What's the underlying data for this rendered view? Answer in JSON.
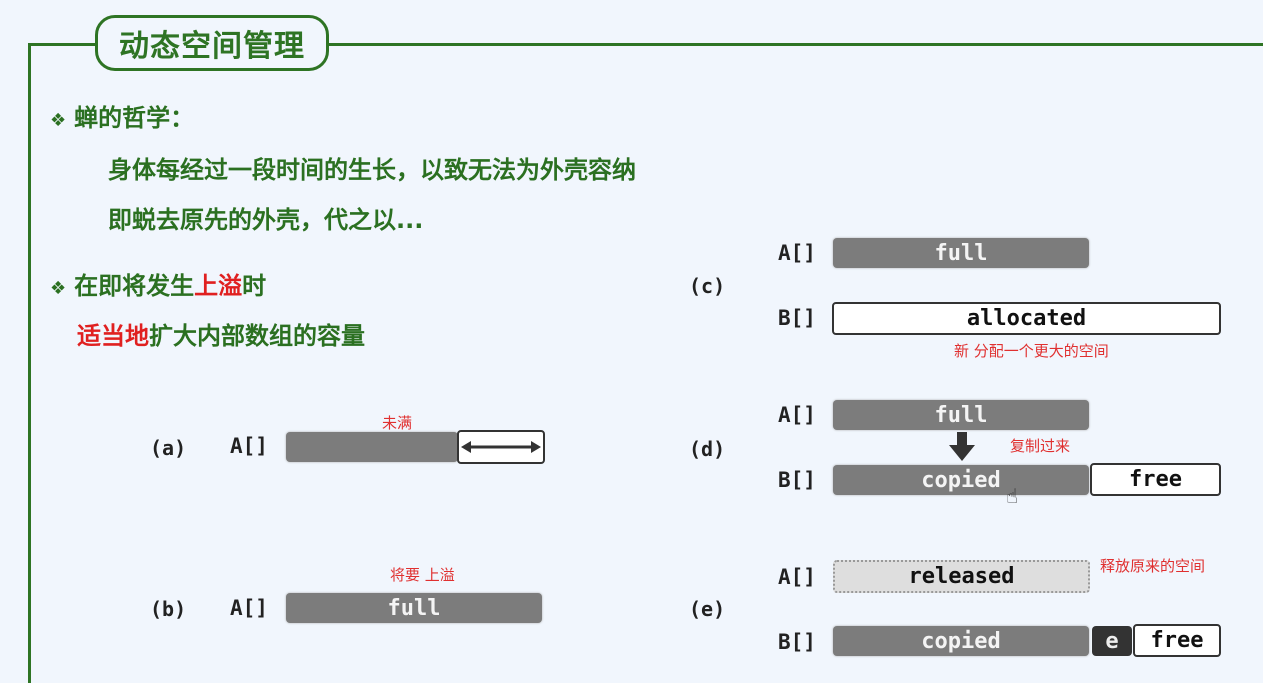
{
  "title": "动态空间管理",
  "bullets": [
    {
      "heading": "蝉的哲学：",
      "lines": [
        "身体每经过一段时间的生长，以致无法为外壳容纳",
        "即蜕去原先的外壳，代之以..."
      ]
    },
    {
      "heading_parts": [
        "在即将发生",
        "上溢",
        "时"
      ],
      "line_parts": [
        "适当地",
        "扩大内部数组的容量"
      ]
    }
  ],
  "diagrams": {
    "a": {
      "label": "(a)",
      "arr": "A[]",
      "note": "未满",
      "icon": "double-arrow-icon"
    },
    "b": {
      "label": "(b)",
      "arr": "A[]",
      "bar": "full",
      "note": "将要 上溢"
    },
    "c": {
      "label": "(c)",
      "arrA": "A[]",
      "barA": "full",
      "arrB": "B[]",
      "barB": "allocated",
      "note": "新 分配一个更大的空间"
    },
    "d": {
      "label": "(d)",
      "arrA": "A[]",
      "barA": "full",
      "arrB": "B[]",
      "barB": "copied",
      "free": "free",
      "note": "复制过来",
      "icon": "down-arrow-icon"
    },
    "e": {
      "label": "(e)",
      "arrA": "A[]",
      "barA": "released",
      "arrB": "B[]",
      "barB": "copied",
      "elem": "e",
      "free": "free",
      "note": "释放原来的空间"
    }
  }
}
